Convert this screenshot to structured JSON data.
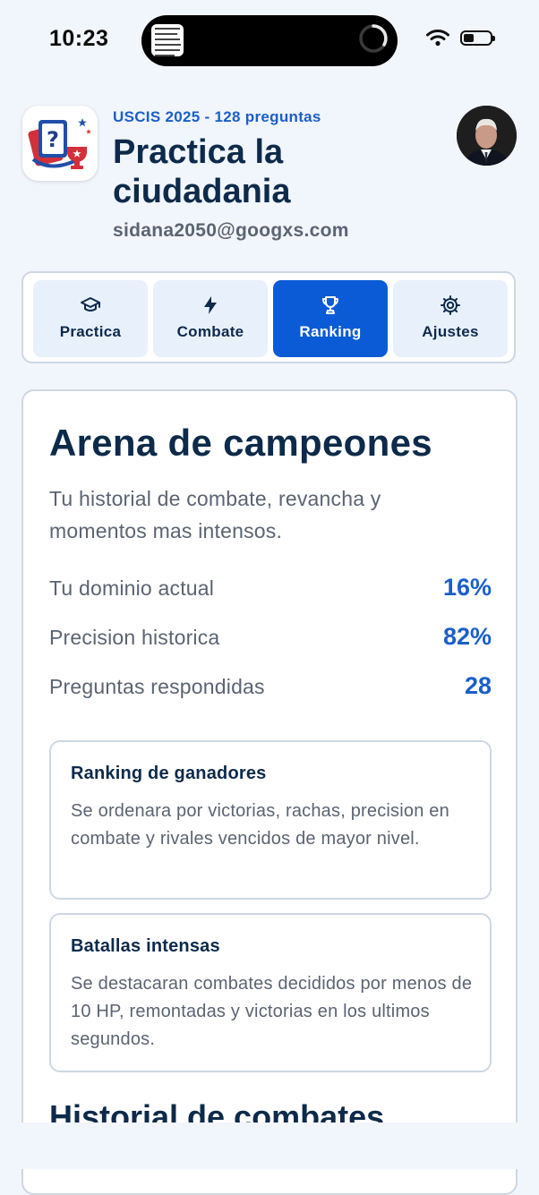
{
  "status_bar": {
    "time": "10:23"
  },
  "header": {
    "subtitle": "USCIS 2025 - 128 preguntas",
    "title": "Practica la ciudadania",
    "email": "sidana2050@googxs.com"
  },
  "tabs": [
    {
      "label": "Practica",
      "icon": "graduation-cap-icon",
      "active": false
    },
    {
      "label": "Combate",
      "icon": "lightning-icon",
      "active": false
    },
    {
      "label": "Ranking",
      "icon": "trophy-icon",
      "active": true
    },
    {
      "label": "Ajustes",
      "icon": "gear-icon",
      "active": false
    }
  ],
  "arena": {
    "title": "Arena de campeones",
    "description": "Tu historial de combate, revancha y momentos mas intensos.",
    "stats": [
      {
        "label": "Tu dominio actual",
        "value": "16%"
      },
      {
        "label": "Precision historica",
        "value": "82%"
      },
      {
        "label": "Preguntas respondidas",
        "value": "28"
      }
    ],
    "ranking_box": {
      "title": "Ranking de ganadores",
      "text": "Se ordenara por victorias, rachas, precision en combate y rivales vencidos de mayor nivel."
    },
    "battles_box": {
      "title": "Batallas intensas",
      "text": "Se destacaran combates decididos por menos de 10 HP, remontadas y victorias en los ultimos segundos."
    },
    "history_title": "Historial de combates"
  },
  "colors": {
    "accent": "#0b5bd6",
    "link_blue": "#1a5fc9",
    "navy": "#0d2a4a",
    "muted": "#5b6472",
    "background": "#f1f5fc"
  }
}
